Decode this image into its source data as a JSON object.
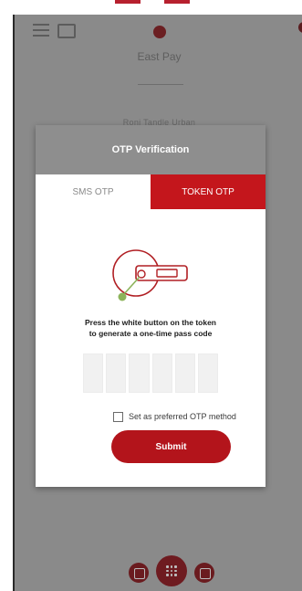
{
  "app": {
    "title": "East Pay",
    "user": "Roni Tandle Urban"
  },
  "modal": {
    "title": "OTP Verification",
    "tabs": [
      {
        "label": "SMS OTP",
        "active": false
      },
      {
        "label": "TOKEN OTP",
        "active": true
      }
    ],
    "instruction_line1": "Press the white button on the token",
    "instruction_line2": "to generate a one-time pass code",
    "otp_digits": [
      "",
      "",
      "",
      "",
      "",
      ""
    ],
    "preferred_label": "Set as preferred OTP method",
    "preferred_checked": false,
    "submit_label": "Submit"
  },
  "colors": {
    "accent": "#c4161c",
    "overlay": "#8a8a8a",
    "header_gray": "#8e8e8e",
    "token_green": "#8cb35a"
  },
  "icons": {
    "menu": "menu-icon",
    "card": "card-icon",
    "logo": "logo-icon",
    "token": "token-key-icon",
    "nav_left": "card-nav-icon",
    "nav_center": "grid-menu-icon",
    "nav_right": "calendar-nav-icon"
  }
}
